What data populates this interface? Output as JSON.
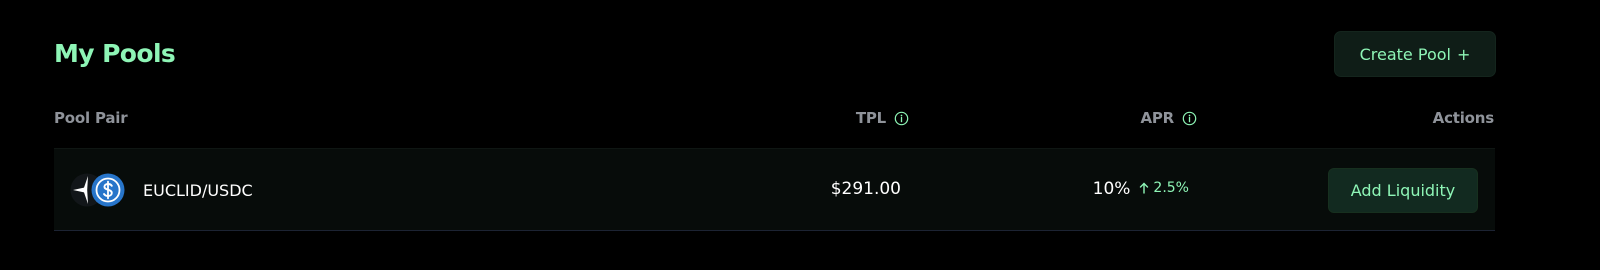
{
  "header": {
    "title": "My Pools",
    "create_button_label": "Create Pool",
    "create_button_icon": "+"
  },
  "table": {
    "columns": {
      "pool_pair": "Pool Pair",
      "tpl": "TPL",
      "apr": "APR",
      "actions": "Actions"
    },
    "rows": [
      {
        "pair": "EUCLID/USDC",
        "tpl": "$291.00",
        "apr": "10%",
        "apr_change": "2.5%",
        "action_label": "Add Liquidity",
        "icons": [
          "euclid-icon",
          "usdc-icon"
        ]
      }
    ]
  },
  "colors": {
    "background": "#000000",
    "accent": "#8ef5b6",
    "button_bg": "#122a20",
    "header_text": "#8f939a",
    "row_bg": "#070c0a"
  }
}
